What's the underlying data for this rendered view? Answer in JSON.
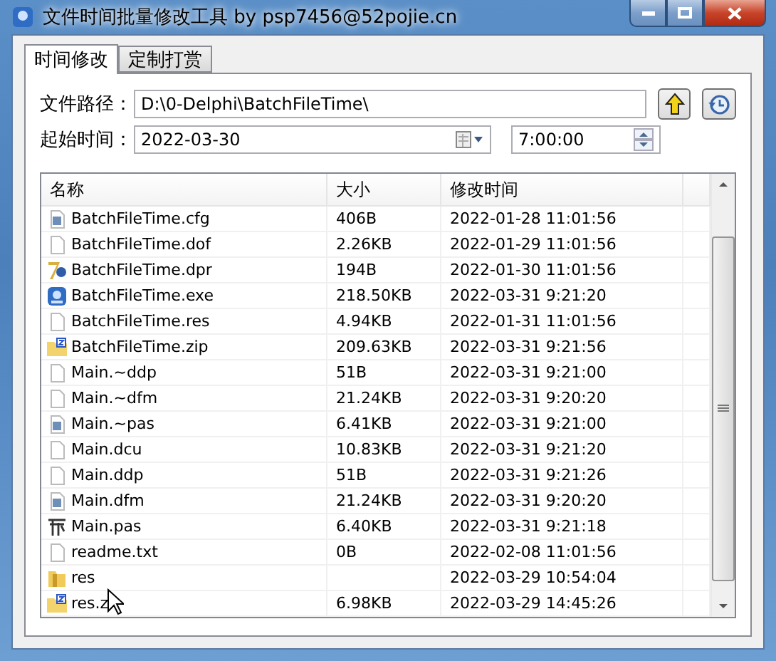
{
  "window": {
    "title": "文件时间批量修改工具 by psp7456@52pojie.cn"
  },
  "tabs": [
    {
      "label": "时间修改",
      "selected": true
    },
    {
      "label": "定制打赏",
      "selected": false
    }
  ],
  "path": {
    "label": "文件路径：",
    "value": "D:\\0-Delphi\\BatchFileTime\\"
  },
  "start": {
    "label": "起始时间：",
    "date": "2022-03-30",
    "time": "7:00:00"
  },
  "table": {
    "columns": [
      "名称",
      "大小",
      "修改时间"
    ],
    "rows": [
      {
        "kind": "config",
        "name": "BatchFileTime.cfg",
        "size": "406B",
        "modified": "2022-01-28 11:01:56"
      },
      {
        "kind": "blank",
        "name": "BatchFileTime.dof",
        "size": "2.26KB",
        "modified": "2022-01-29 11:01:56"
      },
      {
        "kind": "project",
        "name": "BatchFileTime.dpr",
        "size": "194B",
        "modified": "2022-01-30 11:01:56"
      },
      {
        "kind": "app",
        "name": "BatchFileTime.exe",
        "size": "218.50KB",
        "modified": "2022-03-31 9:21:20"
      },
      {
        "kind": "blank",
        "name": "BatchFileTime.res",
        "size": "4.94KB",
        "modified": "2022-01-31 11:01:56"
      },
      {
        "kind": "zip",
        "name": "BatchFileTime.zip",
        "size": "209.63KB",
        "modified": "2022-03-31 9:21:56"
      },
      {
        "kind": "blank",
        "name": "Main.~ddp",
        "size": "51B",
        "modified": "2022-03-31 9:21:00"
      },
      {
        "kind": "blank",
        "name": "Main.~dfm",
        "size": "21.24KB",
        "modified": "2022-03-31 9:20:20"
      },
      {
        "kind": "config",
        "name": "Main.~pas",
        "size": "6.41KB",
        "modified": "2022-03-31 9:21:00"
      },
      {
        "kind": "blank",
        "name": "Main.dcu",
        "size": "10.83KB",
        "modified": "2022-03-31 9:21:20"
      },
      {
        "kind": "blank",
        "name": "Main.ddp",
        "size": "51B",
        "modified": "2022-03-31 9:21:26"
      },
      {
        "kind": "config",
        "name": "Main.dfm",
        "size": "21.24KB",
        "modified": "2022-03-31 9:20:20"
      },
      {
        "kind": "source",
        "name": "Main.pas",
        "size": "6.40KB",
        "modified": "2022-03-31 9:21:18"
      },
      {
        "kind": "blank",
        "name": "readme.txt",
        "size": "0B",
        "modified": "2022-02-08 11:01:56"
      },
      {
        "kind": "folder",
        "name": "res",
        "modified": "2022-03-29 10:54:04"
      },
      {
        "kind": "zip",
        "name": "res.z",
        "size": "6.98KB",
        "modified": "2022-03-29 14:45:26"
      }
    ]
  }
}
